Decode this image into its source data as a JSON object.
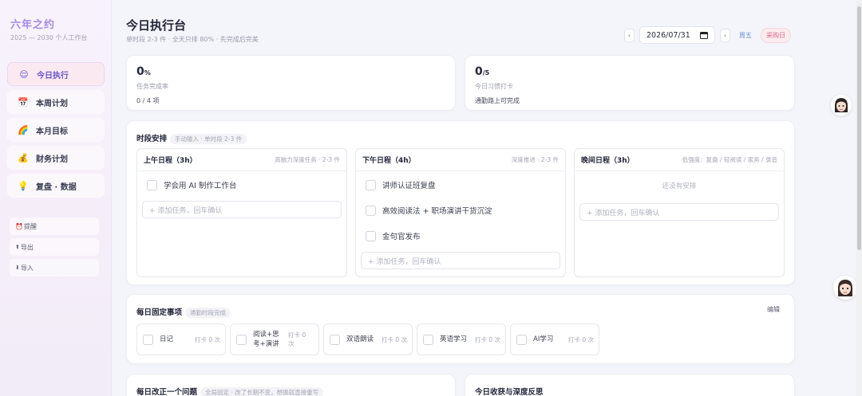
{
  "app": {
    "title": "六年之约",
    "subtitle": "2025 — 2030 个人工作台"
  },
  "nav": [
    {
      "icon": "😌",
      "icon_name": "smile-face-icon",
      "label": "今日执行",
      "active": true
    },
    {
      "icon": "📅",
      "icon_name": "calendar-icon",
      "label": "本周计划"
    },
    {
      "icon": "🌈",
      "icon_name": "rainbow-icon",
      "label": "本月目标"
    },
    {
      "icon": "💰",
      "icon_name": "money-bag-icon",
      "label": "财务计划"
    },
    {
      "icon": "💡",
      "icon_name": "lightbulb-icon",
      "label": "复盘 · 数据"
    }
  ],
  "tools": [
    {
      "icon": "⏰",
      "icon_name": "alarm-clock-icon",
      "label": "提醒"
    },
    {
      "icon": "⬆",
      "icon_name": "export-icon",
      "label": "导出"
    },
    {
      "icon": "⬇",
      "icon_name": "import-icon",
      "label": "导入"
    }
  ],
  "header": {
    "title": "今日执行台",
    "subtitle": "单时段 2-3 件 · 全天只排 80% · 先完成后完美",
    "date": "2026/07/31",
    "prev": "‹",
    "next": "›",
    "weekday": "周五",
    "day_tag": "采购日"
  },
  "stats": [
    {
      "value": "0",
      "unit": "%",
      "label": "任务完成率",
      "sub": "0 / 4 项"
    },
    {
      "value": "0",
      "unit": "/5",
      "label": "今日习惯打卡",
      "sub": "通勤路上可完成"
    }
  ],
  "schedule": {
    "title": "时段安排",
    "hint": "手动输入 · 单时段 2-3 件",
    "columns": [
      {
        "title": "上午日程（3h）",
        "hint": "高脑力深度任务 · 2-3 件",
        "tasks": [
          "学会用 AI 制作工作台"
        ],
        "placeholder": "+ 添加任务，回车确认"
      },
      {
        "title": "下午日程（4h）",
        "hint": "深度推进 · 2-3 件",
        "tasks": [
          "讲师认证班复盘",
          "高效阅读法 + 职场演讲干货沉淀",
          "金句官发布"
        ],
        "placeholder": "+ 添加任务，回车确认"
      },
      {
        "title": "晚间日程（3h）",
        "hint": "低强度：复盘 / 轻阅读 / 家务 / 录音",
        "tasks": [],
        "empty": "还没有安排",
        "placeholder": "+ 添加任务，回车确认"
      }
    ]
  },
  "habits": {
    "title": "每日固定事项",
    "hint": "通勤时段完成",
    "edit": "编辑",
    "items": [
      {
        "name": "日记",
        "count": "打卡 0 次"
      },
      {
        "name": "阅读+思考+演讲",
        "count": "打卡 0 次"
      },
      {
        "name": "双语朗读",
        "count": "打卡 0 次"
      },
      {
        "name": "英语学习",
        "count": "打卡 0 次"
      },
      {
        "name": "AI学习",
        "count": "打卡 0 次"
      }
    ]
  },
  "improve": {
    "title": "每日改正一个问题",
    "hint": "全局固定 · 改了长期不变，想换就直接重写"
  },
  "reflect": {
    "title": "今日收获与深度反思"
  },
  "colors": {
    "accent": "#a58be0",
    "active_bg": "#fbe9f2",
    "tag": "#d86a8e",
    "weekday": "#6e8fd6"
  }
}
